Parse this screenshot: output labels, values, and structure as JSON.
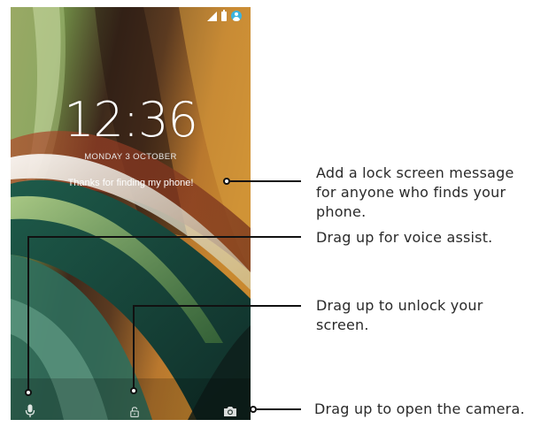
{
  "lockscreen": {
    "time": "12:36",
    "date": "MONDAY 3 OCTOBER",
    "message": "Thanks for finding my phone!",
    "status_icons": [
      "signal-icon",
      "battery-icon",
      "user-icon"
    ],
    "bottom_icons": [
      "microphone-icon",
      "unlock-icon",
      "camera-icon"
    ]
  },
  "callouts": {
    "message_line1": "Add a lock screen message",
    "message_line2": "for anyone who finds your",
    "message_line3": "phone.",
    "voice": "Drag up for voice assist.",
    "unlock_line1": "Drag up to unlock your",
    "unlock_line2": "screen.",
    "camera": "Drag up to open the camera."
  },
  "colors": {
    "text": "#2a2a2a",
    "callout_line": "#111111",
    "accent_user": "#3bb3e0"
  }
}
